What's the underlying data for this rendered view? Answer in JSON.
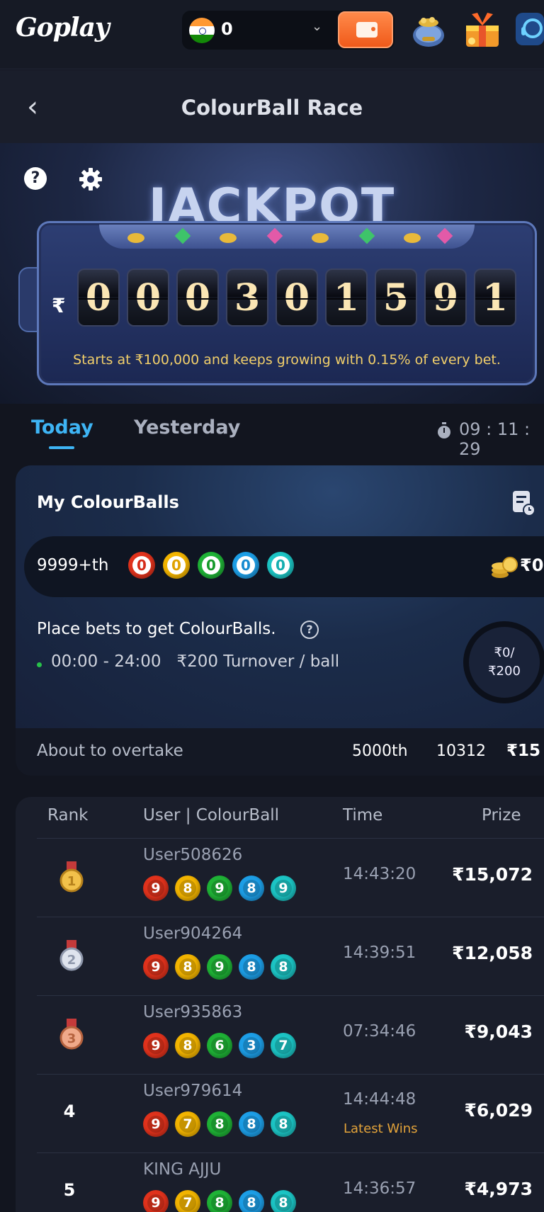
{
  "topbar": {
    "logo": "Goplay",
    "balance": "0",
    "country_flag": "india-flag",
    "icons": [
      "wallet-icon",
      "treasure-pot-icon",
      "gift-box-icon",
      "support-icon"
    ]
  },
  "header": {
    "title": "ColourBall Race"
  },
  "jackpot": {
    "title": "JACKPOT",
    "currency": "₹",
    "digits": [
      "0",
      "0",
      "0",
      "3",
      "0",
      "1",
      "5",
      "9",
      "1"
    ],
    "description": "Starts at ₹100,000 and keeps growing with 0.15% of every bet."
  },
  "tabs": {
    "today": "Today",
    "yesterday": "Yesterday",
    "active": "today"
  },
  "timer": "09 : 11 : 29",
  "my_colourballs": {
    "title": "My ColourBalls",
    "rank": "9999+th",
    "balls": [
      {
        "n": "0",
        "color": "red"
      },
      {
        "n": "0",
        "color": "yellow"
      },
      {
        "n": "0",
        "color": "green"
      },
      {
        "n": "0",
        "color": "blue"
      },
      {
        "n": "0",
        "color": "cyan"
      }
    ],
    "prize": "₹0",
    "place_bets": "Place bets to get ColourBalls.",
    "window": "00:00 - 24:00",
    "rule": "₹200 Turnover / ball",
    "progress_line1": "₹0/",
    "progress_line2": "₹200",
    "progress_fraction": 0,
    "overtake_label": "About to overtake",
    "overtake_rank": "5000th",
    "overtake_number": "10312",
    "overtake_prize": "₹15"
  },
  "ranking": {
    "columns": {
      "rank": "Rank",
      "user": "User | ColourBall",
      "time": "Time",
      "prize": "Prize"
    },
    "rows": [
      {
        "rank": "1",
        "medal": "gold-medal-icon",
        "user": "User508626",
        "balls": [
          "9",
          "8",
          "9",
          "8",
          "9"
        ],
        "time": "14:43:20",
        "prize": "₹15,072"
      },
      {
        "rank": "2",
        "medal": "silver-medal-icon",
        "user": "User904264",
        "balls": [
          "9",
          "8",
          "9",
          "8",
          "8"
        ],
        "time": "14:39:51",
        "prize": "₹12,058"
      },
      {
        "rank": "3",
        "medal": "bronze-medal-icon",
        "user": "User935863",
        "balls": [
          "9",
          "8",
          "6",
          "3",
          "7"
        ],
        "time": "07:34:46",
        "prize": "₹9,043"
      },
      {
        "rank": "4",
        "medal": "",
        "user": "User979614",
        "balls": [
          "9",
          "7",
          "8",
          "8",
          "8"
        ],
        "time": "14:44:48",
        "tag": "Latest Wins",
        "prize": "₹6,029"
      },
      {
        "rank": "5",
        "medal": "",
        "user": "KING AJJU",
        "balls": [
          "9",
          "7",
          "8",
          "8",
          "8"
        ],
        "time": "14:36:57",
        "prize": "₹4,973"
      }
    ]
  }
}
